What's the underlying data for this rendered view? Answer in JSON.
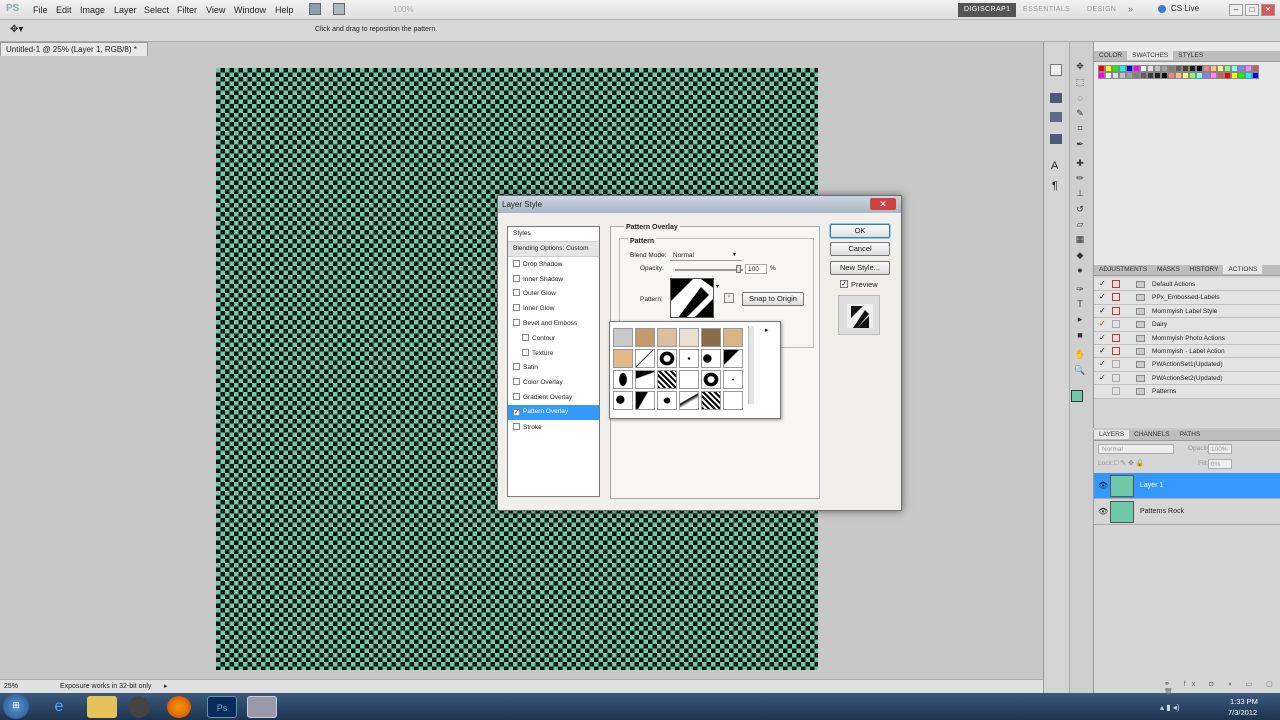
{
  "menubar": {
    "logo": "PS",
    "menus": [
      "File",
      "Edit",
      "Image",
      "Layer",
      "Select",
      "Filter",
      "View",
      "Window",
      "Help"
    ],
    "zoom": "100%",
    "workspaces": [
      "DIGISCRAP1",
      "ESSENTIALS",
      "DESIGN"
    ],
    "cs_live": "CS Live"
  },
  "options": {
    "hint": "Click and drag to reposition the pattern."
  },
  "document": {
    "tab": "Untitled-1 @ 25% (Layer 1, RGB/8) *",
    "canvas_colors": {
      "base": "#6fcaa9",
      "pattern": "#111111"
    }
  },
  "status": {
    "zoom": "25%",
    "info": "Exposure works in 32-bit only"
  },
  "taskbar": {
    "time": "1:33 PM",
    "date": "7/3/2012",
    "ps_label": "Ps"
  },
  "swatches_panel": {
    "tabs": [
      "COLOR",
      "SWATCHES",
      "STYLES"
    ],
    "active": "SWATCHES"
  },
  "actions_panel": {
    "tabs": [
      "ADJUSTMENTS",
      "MASKS",
      "HISTORY",
      "ACTIONS"
    ],
    "active": "ACTIONS",
    "items": [
      "Default Actions",
      "PPx_Embossed-Labels",
      "Mommyish Label Style",
      "Dairy",
      "Mommyish Photo Actions",
      "Mommyish - Label Action",
      "PWActionSet1(Updated)",
      "PWActionSet2(Updated)",
      "Patterns"
    ]
  },
  "layers_panel": {
    "tabs": [
      "LAYERS",
      "CHANNELS",
      "PATHS"
    ],
    "active": "LAYERS",
    "blend": "Normal",
    "opacity_label": "Opacity:",
    "opacity": "100%",
    "lock_label": "Lock:",
    "fill_label": "Fill:",
    "fill": "0%",
    "layers": [
      "Layer 1",
      "Patterns Rock"
    ]
  },
  "dialog": {
    "title": "Layer Style",
    "styles_header": "Styles",
    "blending": "Blending Options: Custom",
    "effects": [
      "Drop Shadow",
      "Inner Shadow",
      "Outer Glow",
      "Inner Glow",
      "Bevel and Emboss",
      "Contour",
      "Texture",
      "Satin",
      "Color Overlay",
      "Gradient Overlay",
      "Pattern Overlay",
      "Stroke"
    ],
    "selected_effect": "Pattern Overlay",
    "section_title": "Pattern Overlay",
    "group_title": "Pattern",
    "blend_label": "Blend Mode:",
    "blend_value": "Normal",
    "opacity_label": "Opacity:",
    "opacity_value": "100",
    "opacity_unit": "%",
    "pattern_label": "Pattern:",
    "snap_button": "Snap to Origin",
    "ok": "OK",
    "cancel": "Cancel",
    "new_style": "New Style...",
    "preview_label": "Preview"
  }
}
